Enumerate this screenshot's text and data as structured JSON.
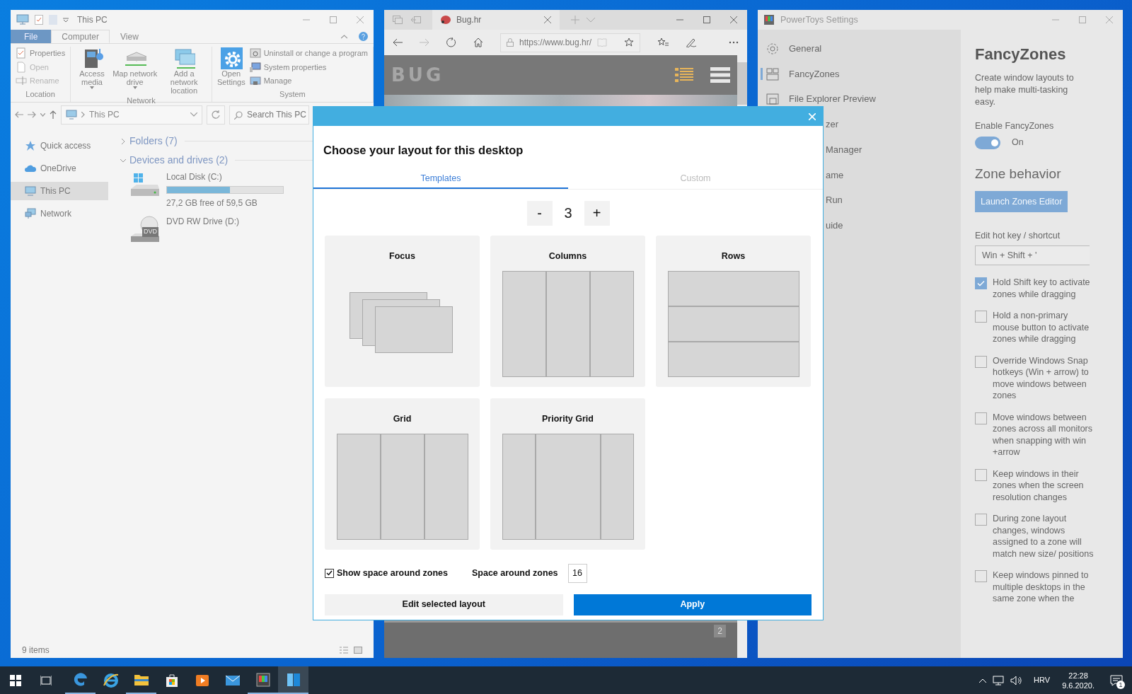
{
  "explorer": {
    "title": "This PC",
    "ribbon_tabs": [
      {
        "label": "File",
        "kind": "file",
        "selected": false
      },
      {
        "label": "Computer",
        "kind": "tab",
        "selected": true
      },
      {
        "label": "View",
        "kind": "tab",
        "selected": false
      }
    ],
    "ribbon_groups": [
      {
        "name": "Location",
        "commands": [
          {
            "label": "Properties",
            "kind": "small",
            "disabled": false
          },
          {
            "label": "Open",
            "kind": "small",
            "disabled": true
          },
          {
            "label": "Rename",
            "kind": "small",
            "disabled": true
          }
        ]
      },
      {
        "name": "Network",
        "commands": [
          {
            "label": "Access media",
            "kind": "large",
            "dropdown": true
          },
          {
            "label": "Map network drive",
            "kind": "large",
            "dropdown": true
          },
          {
            "label": "Add a network location",
            "kind": "large",
            "dropdown": false
          }
        ]
      },
      {
        "name": "System",
        "commands": [
          {
            "label": "Open Settings",
            "kind": "large",
            "dropdown": false
          },
          {
            "label": "Uninstall or change a program",
            "kind": "small",
            "disabled": false
          },
          {
            "label": "System properties",
            "kind": "small",
            "disabled": false
          },
          {
            "label": "Manage",
            "kind": "small",
            "disabled": false
          }
        ]
      }
    ],
    "address": "This PC",
    "search_placeholder": "Search This PC",
    "nav": [
      {
        "label": "Quick access",
        "kind": "star",
        "selected": false
      },
      {
        "label": "OneDrive",
        "kind": "cloud",
        "selected": false
      },
      {
        "label": "This PC",
        "kind": "pc",
        "selected": true
      },
      {
        "label": "Network",
        "kind": "network",
        "selected": false
      }
    ],
    "groups": [
      {
        "label": "Folders (7)",
        "expanded": false
      },
      {
        "label": "Devices and drives (2)",
        "expanded": true,
        "drives": [
          {
            "name": "Local Disk (C:)",
            "kind": "disk",
            "level": 0.54,
            "detail": "27,2 GB free of 59,5 GB"
          },
          {
            "name": "DVD RW Drive (D:)",
            "kind": "dvd",
            "badge": "DVD"
          }
        ]
      }
    ],
    "status": "9 items"
  },
  "browser": {
    "tab": "Bug.hr",
    "url": "https://www.bug.hr/",
    "site_logo": "BUG",
    "slide_number": "2"
  },
  "powertoys": {
    "title": "PowerToys Settings",
    "nav": [
      {
        "label": "General",
        "kind": "full",
        "selected": false
      },
      {
        "label": "FancyZones",
        "kind": "full",
        "selected": true
      },
      {
        "label": "File Explorer Preview",
        "kind": "full",
        "selected": false
      },
      {
        "label": "zer",
        "kind": "partial",
        "selected": false
      },
      {
        "label": "Manager",
        "kind": "partial",
        "selected": false
      },
      {
        "label": "ame",
        "kind": "partial",
        "selected": false
      },
      {
        "label": "Run",
        "kind": "partial",
        "selected": false
      },
      {
        "label": "uide",
        "kind": "partial",
        "selected": false
      }
    ],
    "heading": "FancyZones",
    "description": "Create window layouts to help make multi-tasking easy.",
    "enable_label": "Enable FancyZones",
    "toggle": {
      "on": true,
      "label": "On"
    },
    "section": "Zone behavior",
    "launch_button": "Launch Zones Editor",
    "hotkey_label": "Edit hot key / shortcut",
    "hotkey_value": "Win + Shift + '",
    "options": [
      {
        "label": "Hold Shift key to activate zones while dragging",
        "checked": true
      },
      {
        "label": "Hold a non-primary mouse button to activate zones while dragging",
        "checked": false
      },
      {
        "label": "Override Windows Snap hotkeys (Win + arrow) to move windows between zones",
        "checked": false
      },
      {
        "label": "Move windows between zones across all monitors when snapping with win +arrow",
        "checked": false
      },
      {
        "label": "Keep windows in their zones when the screen resolution changes",
        "checked": false
      },
      {
        "label": "During zone layout changes, windows assigned to a zone will match new size/ positions",
        "checked": false
      },
      {
        "label": "Keep windows pinned to multiple desktops in the same zone when the",
        "checked": false
      }
    ]
  },
  "dialog": {
    "title": "Choose your layout for this desktop",
    "tabs": [
      {
        "label": "Templates",
        "selected": true
      },
      {
        "label": "Custom",
        "selected": false
      }
    ],
    "decrement": "-",
    "zone_count": "3",
    "increment": "+",
    "layouts": [
      {
        "name": "Focus",
        "kind": "focus"
      },
      {
        "name": "Columns",
        "kind": "columns"
      },
      {
        "name": "Rows",
        "kind": "rows"
      },
      {
        "name": "Grid",
        "kind": "grid"
      },
      {
        "name": "Priority Grid",
        "kind": "priority"
      }
    ],
    "show_space": {
      "label": "Show space around zones",
      "checked": true
    },
    "space": {
      "label": "Space around zones",
      "value": "16"
    },
    "buttons": [
      {
        "label": "Edit selected layout",
        "kind": "secondary"
      },
      {
        "label": "Apply",
        "kind": "primary"
      }
    ]
  },
  "taskbar": {
    "apps": [
      {
        "kind": "edge",
        "running": true,
        "selected": false
      },
      {
        "kind": "ie",
        "running": false,
        "selected": false
      },
      {
        "kind": "folder",
        "running": true,
        "selected": false
      },
      {
        "kind": "store",
        "running": false,
        "selected": false
      },
      {
        "kind": "media",
        "running": false,
        "selected": false
      },
      {
        "kind": "mail",
        "running": false,
        "selected": false
      },
      {
        "kind": "powertoys",
        "running": true,
        "selected": false
      },
      {
        "kind": "fancyzones",
        "running": true,
        "selected": true
      }
    ],
    "language": "HRV",
    "time": "22:28",
    "date": "9.6.2020.",
    "notifications": "1"
  }
}
